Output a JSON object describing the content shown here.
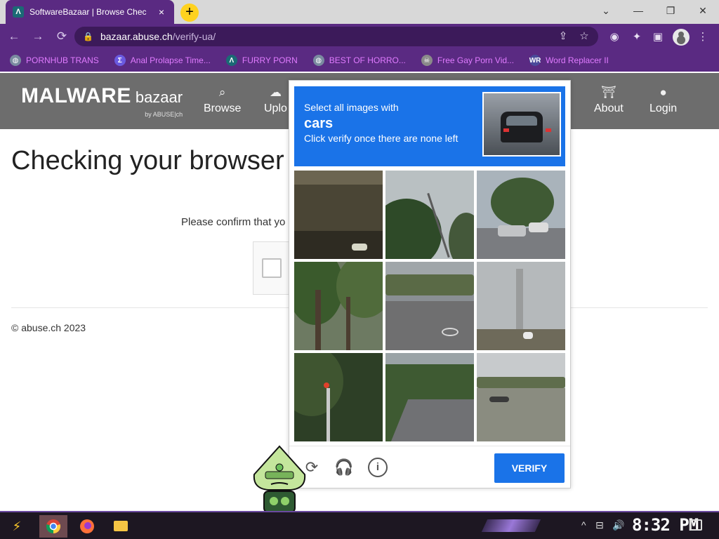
{
  "browser": {
    "tab": {
      "favicon": "Λ",
      "title": "SoftwareBazaar | Browse Chec",
      "close": "×"
    },
    "newtab": "+",
    "window": {
      "minimize": "⌄",
      "min": "—",
      "restore": "❐",
      "close": "✕"
    },
    "nav": {
      "back": "←",
      "forward": "→",
      "reload": "⟳"
    },
    "address": {
      "host": "bazaar.abuse.ch",
      "path": "/verify-ua/"
    },
    "bookmarks": [
      {
        "label": "PORNHUB TRANS",
        "icon": "globe-icon",
        "glyph": "◍",
        "color": "#7a8aa0"
      },
      {
        "label": "Anal Prolapse Time...",
        "icon": "brackets-icon",
        "glyph": "Σ",
        "color": "#6a5ae0"
      },
      {
        "label": "FURRY PORN",
        "icon": "lambda-icon",
        "glyph": "Λ",
        "color": "#1b6a75"
      },
      {
        "label": "BEST OF HORRO...",
        "icon": "globe-icon",
        "glyph": "◍",
        "color": "#7a8aa0"
      },
      {
        "label": "Free Gay Porn Vid...",
        "icon": "skull-icon",
        "glyph": "☠",
        "color": "#8a8a8a"
      },
      {
        "label": "Word Replacer II",
        "icon": "wr-icon",
        "glyph": "WR",
        "color": "#4a4a9a"
      }
    ]
  },
  "site": {
    "logo": {
      "main": "MALWARE",
      "sub": "bazaar",
      "by": "by ABUSE|ch"
    },
    "nav": [
      {
        "label": "Browse",
        "icon": "search-icon",
        "glyph": "🔍"
      },
      {
        "label": "Uplo",
        "icon": "upload-cloud-icon",
        "glyph": "☁"
      },
      {
        "label": "About",
        "icon": "building-icon",
        "glyph": "⌂"
      },
      {
        "label": "Login",
        "icon": "user-icon",
        "glyph": "👤"
      }
    ],
    "title": "Checking your browser",
    "confirm_text": "Please confirm that yo",
    "footer": "© abuse.ch 2023"
  },
  "captcha": {
    "line1": "Select all images with",
    "target": "cars",
    "line3": "Click verify once there are none left",
    "verify_label": "VERIFY",
    "reload_icon": "⟳",
    "audio_icon": "🎧",
    "info_icon": "i"
  },
  "taskbar": {
    "clock": "8:32 PM",
    "tray": [
      "^",
      "⊟",
      "🔊"
    ]
  }
}
